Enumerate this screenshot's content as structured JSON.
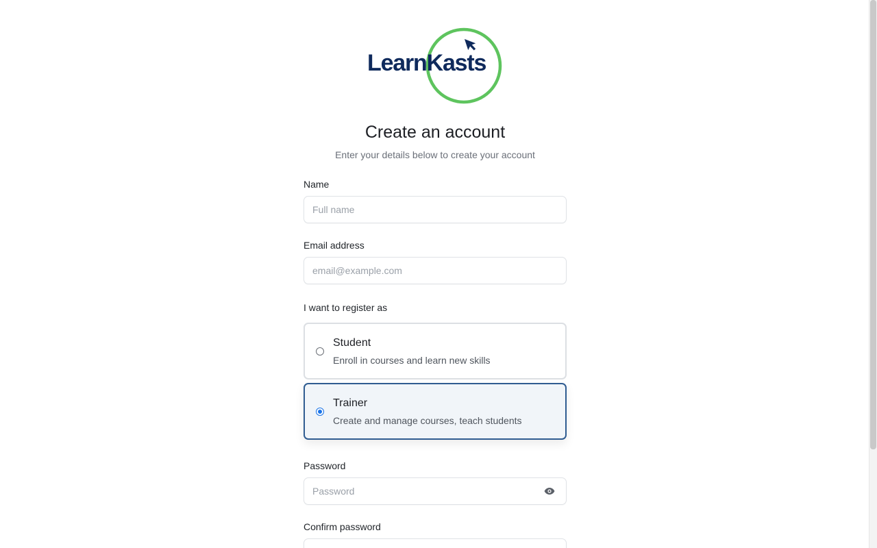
{
  "logo": {
    "text": "LearnKasts",
    "ring_color": "#5ec45e",
    "text_color": "#0f2a5c",
    "icon": "cursor-arrow-icon"
  },
  "header": {
    "title": "Create an account",
    "subtitle": "Enter your details below to create your account"
  },
  "form": {
    "name": {
      "label": "Name",
      "placeholder": "Full name",
      "value": ""
    },
    "email": {
      "label": "Email address",
      "placeholder": "email@example.com",
      "value": ""
    },
    "role": {
      "label": "I want to register as",
      "selected": "trainer",
      "options": [
        {
          "id": "student",
          "title": "Student",
          "description": "Enroll in courses and learn new skills",
          "checked": false
        },
        {
          "id": "trainer",
          "title": "Trainer",
          "description": "Create and manage courses, teach students",
          "checked": true
        }
      ]
    },
    "password": {
      "label": "Password",
      "placeholder": "Password",
      "value": "",
      "toggle_icon": "eye-icon"
    },
    "confirm_password": {
      "label": "Confirm password"
    }
  },
  "colors": {
    "accent": "#1a73e8",
    "selected_border": "#2f5c91",
    "selected_bg": "#f1f5f9"
  }
}
